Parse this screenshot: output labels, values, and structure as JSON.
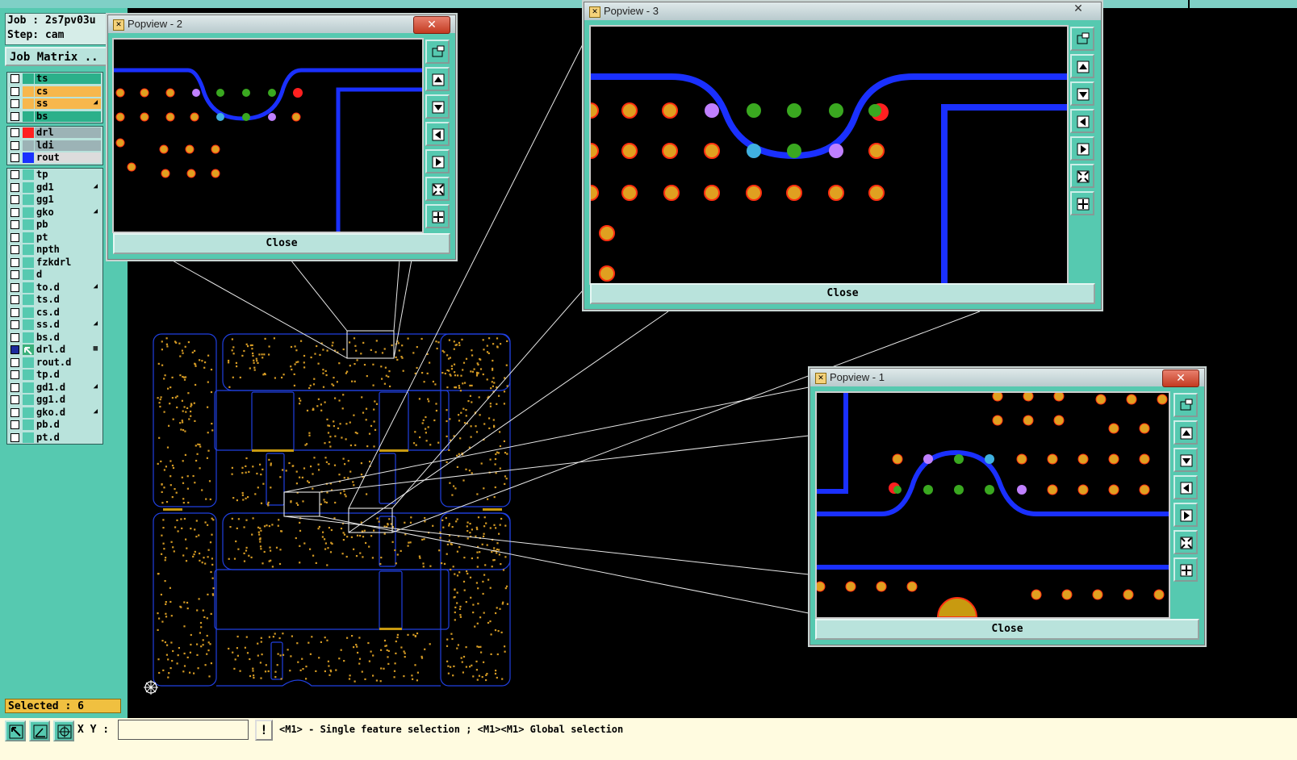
{
  "job": {
    "job_line": "Job : 2s7pv03u",
    "step_line": "Step: cam"
  },
  "job_matrix_label": "Job Matrix ..",
  "layer_groups": [
    [
      {
        "name": "ts",
        "color": "#2bb08a",
        "bg": "#2bb08a",
        "flag": ""
      },
      {
        "name": "cs",
        "color": "#f7b74c",
        "bg": "#f7b74c",
        "flag": ""
      },
      {
        "name": "ss",
        "color": "#f7b74c",
        "bg": "#f7b74c",
        "flag": "◢"
      },
      {
        "name": "bs",
        "color": "#2bb08a",
        "bg": "#2bb08a",
        "flag": ""
      }
    ],
    [
      {
        "name": "drl",
        "color": "#ff2020",
        "bg": "#9cb3b6",
        "flag": ""
      },
      {
        "name": "ldi",
        "color": "#9cb3b6",
        "bg": "#9cb3b6",
        "flag": ""
      },
      {
        "name": "rout",
        "color": "#1a30ff",
        "bg": "#dcdcdc",
        "flag": ""
      }
    ],
    [
      {
        "name": "tp",
        "color": "#56c9b0",
        "bg": "#b9e3dc",
        "flag": ""
      },
      {
        "name": "gd1",
        "color": "#56c9b0",
        "bg": "#b9e3dc",
        "flag": "◢"
      },
      {
        "name": "gg1",
        "color": "#56c9b0",
        "bg": "#b9e3dc",
        "flag": ""
      },
      {
        "name": "gko",
        "color": "#56c9b0",
        "bg": "#b9e3dc",
        "flag": "◢"
      },
      {
        "name": "pb",
        "color": "#56c9b0",
        "bg": "#b9e3dc",
        "flag": ""
      },
      {
        "name": "pt",
        "color": "#56c9b0",
        "bg": "#b9e3dc",
        "flag": ""
      },
      {
        "name": "npth",
        "color": "#56c9b0",
        "bg": "#b9e3dc",
        "flag": ""
      },
      {
        "name": "fzkdrl",
        "color": "#56c9b0",
        "bg": "#b9e3dc",
        "flag": ""
      },
      {
        "name": "d",
        "color": "#56c9b0",
        "bg": "#b9e3dc",
        "flag": ""
      },
      {
        "name": "to.d",
        "color": "#56c9b0",
        "bg": "#b9e3dc",
        "flag": "◢"
      },
      {
        "name": "ts.d",
        "color": "#56c9b0",
        "bg": "#b9e3dc",
        "flag": ""
      },
      {
        "name": "cs.d",
        "color": "#56c9b0",
        "bg": "#b9e3dc",
        "flag": ""
      },
      {
        "name": "ss.d",
        "color": "#56c9b0",
        "bg": "#b9e3dc",
        "flag": "◢"
      },
      {
        "name": "bs.d",
        "color": "#56c9b0",
        "bg": "#b9e3dc",
        "flag": ""
      },
      {
        "name": "drl.d",
        "color": "#3ab07a",
        "bg": "#b9e3dc",
        "flag": "▦",
        "active": true
      },
      {
        "name": "rout.d",
        "color": "#56c9b0",
        "bg": "#b9e3dc",
        "flag": ""
      },
      {
        "name": "tp.d",
        "color": "#56c9b0",
        "bg": "#b9e3dc",
        "flag": ""
      },
      {
        "name": "gd1.d",
        "color": "#56c9b0",
        "bg": "#b9e3dc",
        "flag": "◢"
      },
      {
        "name": "gg1.d",
        "color": "#56c9b0",
        "bg": "#b9e3dc",
        "flag": ""
      },
      {
        "name": "gko.d",
        "color": "#56c9b0",
        "bg": "#b9e3dc",
        "flag": "◢"
      },
      {
        "name": "pb.d",
        "color": "#56c9b0",
        "bg": "#b9e3dc",
        "flag": ""
      },
      {
        "name": "pt.d",
        "color": "#56c9b0",
        "bg": "#b9e3dc",
        "flag": ""
      }
    ]
  ],
  "selected_label": "Selected : 6",
  "bottom": {
    "xy_label": "X Y :",
    "xy_value": "",
    "info_label": "!",
    "hint": "<M1> - Single feature selection ; <M1><M1> Global selection"
  },
  "popups": {
    "p2": {
      "title": "Popview - 2",
      "close": "Close",
      "x": "✕"
    },
    "p3": {
      "title": "Popview - 3",
      "close": "Close",
      "x": "✕"
    },
    "p1": {
      "title": "Popview - 1",
      "close": "Close",
      "x": "✕"
    }
  },
  "colors": {
    "pad": "#e0a020",
    "pad_edge": "#ff3010",
    "trace": "#1a30ff",
    "via_green": "#3aa820",
    "via_purple": "#c080ff",
    "via_cyan": "#40b0e0",
    "drill_red": "#ff2020",
    "board_outline": "#2040e0"
  }
}
